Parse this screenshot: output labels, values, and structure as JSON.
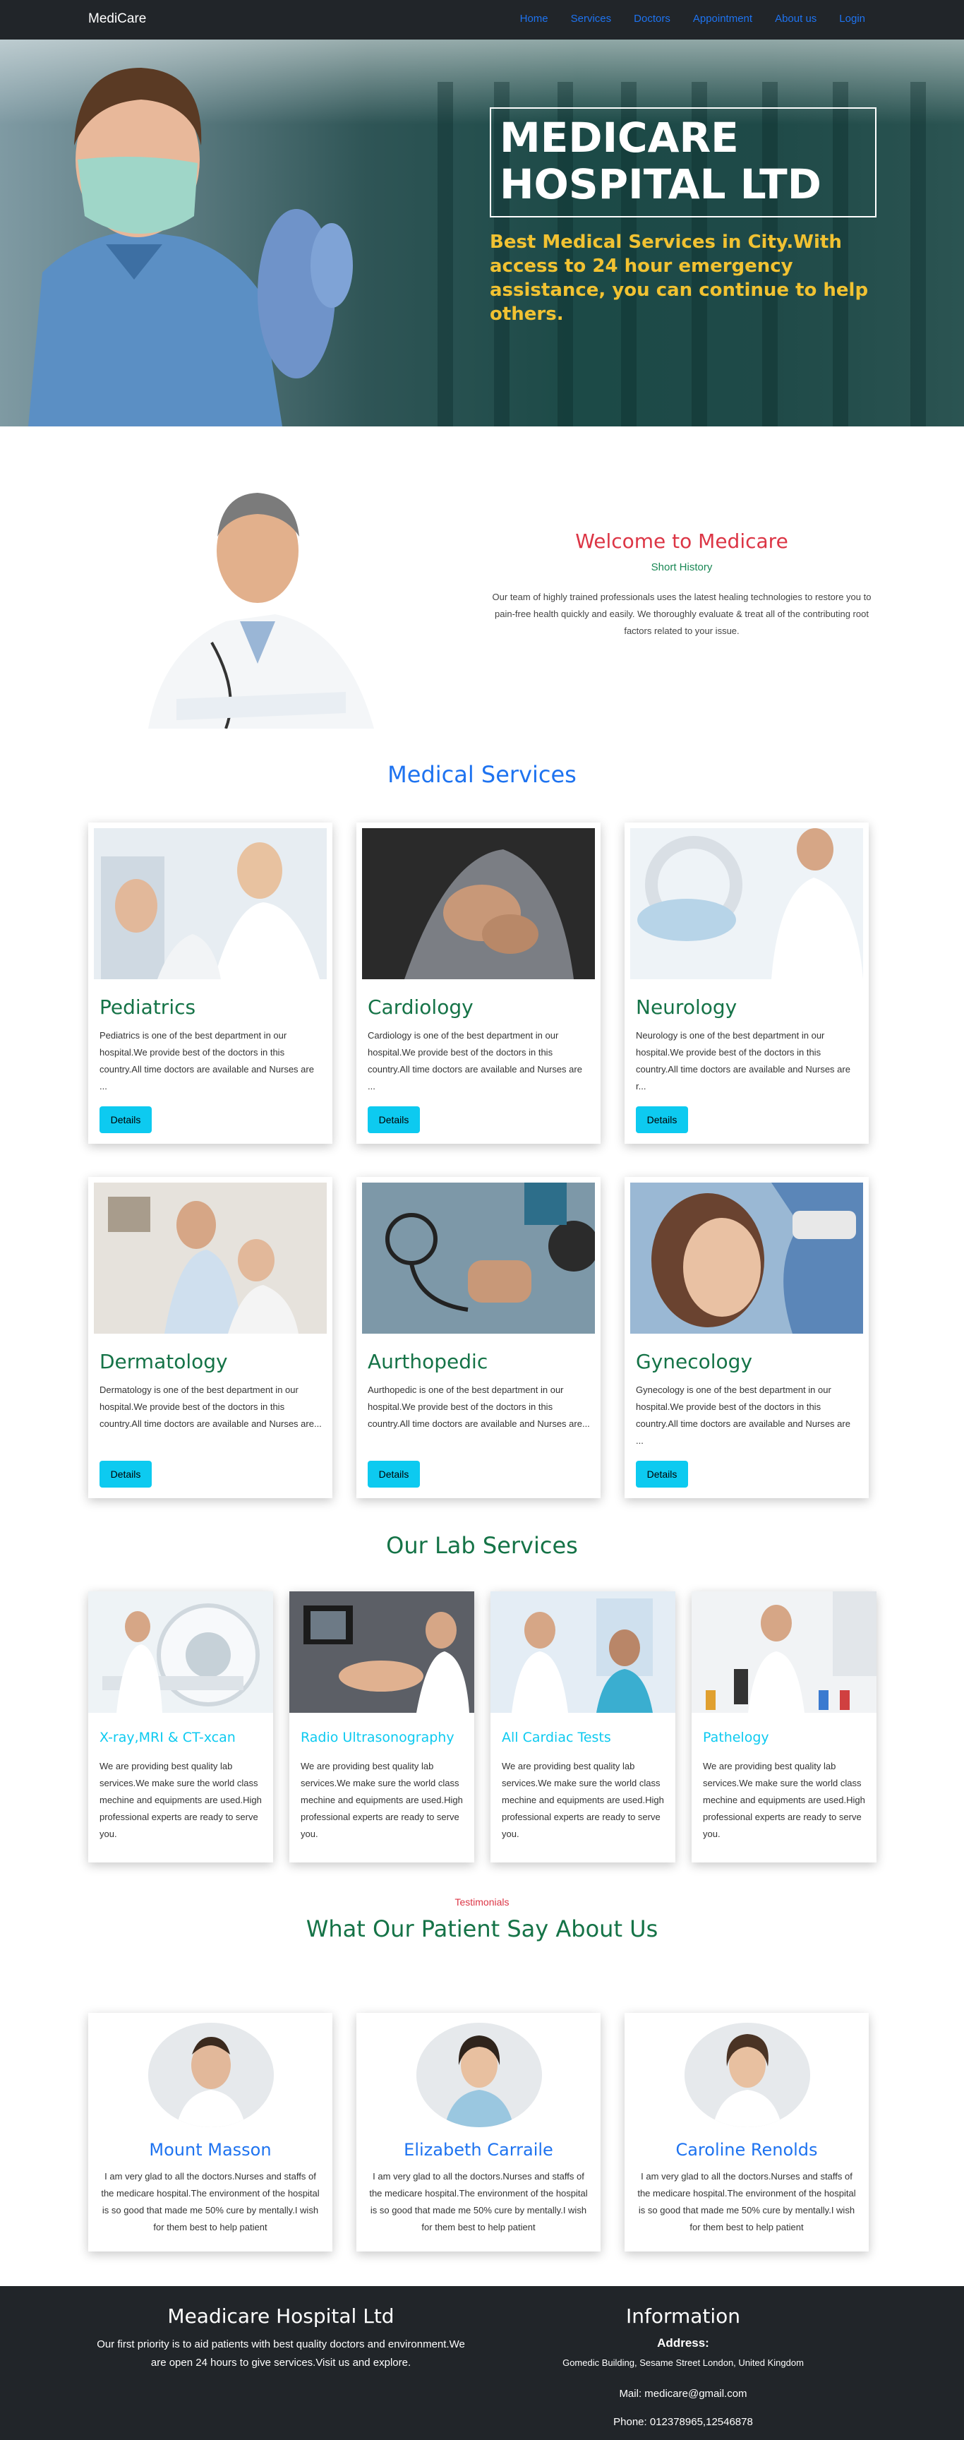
{
  "nav": {
    "brand": "MediCare",
    "links": [
      "Home",
      "Services",
      "Doctors",
      "Appointment",
      "About us",
      "Login"
    ]
  },
  "hero": {
    "title": "MEDICARE HOSPITAL LTD",
    "subtitle": "Best Medical Services in City.With access to 24 hour emergency assistance, you can continue to help others."
  },
  "welcome": {
    "title": "Welcome to Medicare",
    "subtitle": "Short History",
    "text": "Our team of highly trained professionals uses the latest healing technologies to restore you to pain-free health quickly and easily. We thoroughly evaluate & treat all of the contributing root factors related to your issue."
  },
  "services": {
    "title": "Medical Services",
    "button_label": "Details",
    "items": [
      {
        "name": "Pediatrics",
        "desc": "Pediatrics is one of the best department in our hospital.We provide best of the doctors in this country.All time doctors are available and Nurses are ..."
      },
      {
        "name": "Cardiology",
        "desc": "Cardiology is one of the best department in our hospital.We provide best of the doctors in this country.All time doctors are available and Nurses are ..."
      },
      {
        "name": "Neurology",
        "desc": "Neurology is one of the best department in our hospital.We provide best of the doctors in this country.All time doctors are available and Nurses are r..."
      },
      {
        "name": "Dermatology",
        "desc": "Dermatology is one of the best department in our hospital.We provide best of the doctors in this country.All time doctors are available and Nurses are..."
      },
      {
        "name": "Aurthopedic",
        "desc": "Aurthopedic is one of the best department in our hospital.We provide best of the doctors in this country.All time doctors are available and Nurses are..."
      },
      {
        "name": "Gynecology",
        "desc": "Gynecology is one of the best department in our hospital.We provide best of the doctors in this country.All time doctors are available and Nurses are ..."
      }
    ]
  },
  "labs": {
    "title": "Our Lab Services",
    "items": [
      {
        "name": "X-ray,MRI & CT-xcan",
        "desc": "We are providing best quality lab services.We make sure the world class mechine and equipments are used.High professional experts are ready to serve you."
      },
      {
        "name": "Radio Ultrasonography",
        "desc": "We are providing best quality lab services.We make sure the world class mechine and equipments are used.High professional experts are ready to serve you."
      },
      {
        "name": "All Cardiac Tests",
        "desc": "We are providing best quality lab services.We make sure the world class mechine and equipments are used.High professional experts are ready to serve you."
      },
      {
        "name": "Pathelogy",
        "desc": "We are providing best quality lab services.We make sure the world class mechine and equipments are used.High professional experts are ready to serve you."
      }
    ]
  },
  "testimonials": {
    "label": "Testimonials",
    "title": "What Our Patient Say About Us",
    "items": [
      {
        "name": "Mount Masson",
        "text": "I am very glad to all the doctors.Nurses and staffs of the medicare hospital.The environment of the hospital is so good that made me 50% cure by mentally.I wish for them best to help patient"
      },
      {
        "name": "Elizabeth Carraile",
        "text": "I am very glad to all the doctors.Nurses and staffs of the medicare hospital.The environment of the hospital is so good that made me 50% cure by mentally.I wish for them best to help patient"
      },
      {
        "name": "Caroline Renolds",
        "text": "I am very glad to all the doctors.Nurses and staffs of the medicare hospital.The environment of the hospital is so good that made me 50% cure by mentally.I wish for them best to help patient"
      }
    ]
  },
  "footer": {
    "title": "Meadicare Hospital Ltd",
    "text": "Our first priority is to aid patients with best quality doctors and environment.We are open 24 hours to give services.Visit us and explore.",
    "info_title": "Information",
    "address_label": "Address:",
    "address": "Gomedic Building, Sesame Street London, United Kingdom",
    "mail": "Mail: medicare@gmail.com",
    "phone": "Phone: 012378965,12546878"
  },
  "colors": {
    "nav_bg": "#212529",
    "link": "#1e73f0",
    "hero_sub": "#f1c232",
    "welcome": "#dc3545",
    "green": "#157347",
    "cyan": "#0dcaf0"
  }
}
